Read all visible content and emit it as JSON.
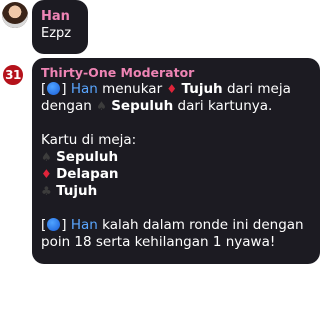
{
  "message1": {
    "author": "Han",
    "text": "Ezpz"
  },
  "moderator": {
    "badge_text": "31",
    "name": "Thirty-One Moderator",
    "line1": {
      "open": "[",
      "close": "]",
      "player": "Han",
      "verb": "menukar",
      "card1": "Tujuh",
      "rest": "dari meja"
    },
    "line2": {
      "pre": "dengan",
      "card2": "Sepuluh",
      "rest": "dari kartunya."
    },
    "table_heading": "Kartu di meja:",
    "table_cards": [
      {
        "suit": "spade",
        "suit_color": "#3c3c3c",
        "label": "Sepuluh"
      },
      {
        "suit": "diamond",
        "suit_color": "#e0243a",
        "label": "Delapan"
      },
      {
        "suit": "club",
        "suit_color": "#3c3c3c",
        "label": "Tujuh"
      }
    ],
    "result_line1": {
      "open": "[",
      "close": "]",
      "player": "Han",
      "text": "kalah dalam ronde ini dengan"
    },
    "result_line2": "poin 18 serta kehilangan 1 nyawa!"
  },
  "colors": {
    "bubble_bg": "#1c1b22",
    "author": "#ee84b4",
    "player_highlight": "#5aa6ff"
  }
}
